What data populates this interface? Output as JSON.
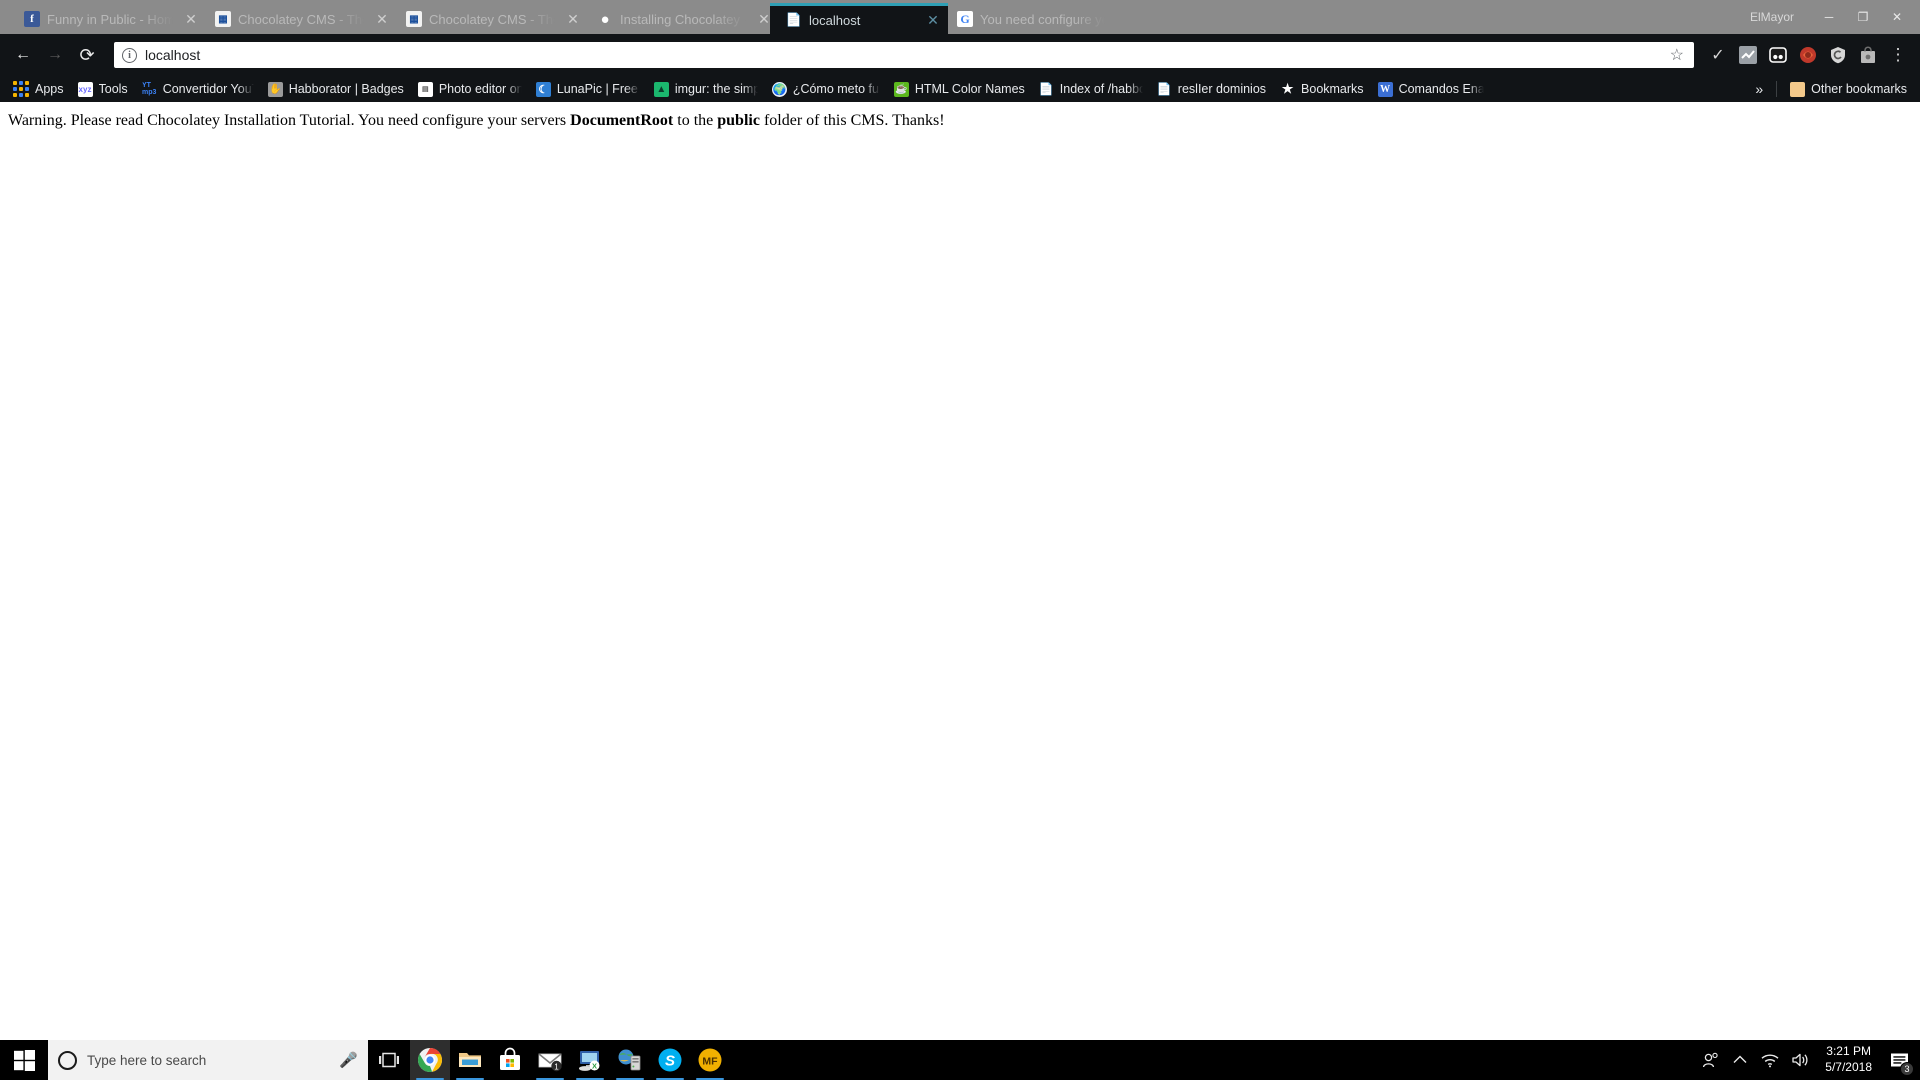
{
  "window": {
    "username": "ElMayor",
    "controls": [
      {
        "name": "minimize",
        "glyph": "─"
      },
      {
        "name": "maximize",
        "glyph": "❐"
      },
      {
        "name": "close",
        "glyph": "✕"
      }
    ]
  },
  "tabs": [
    {
      "title": "Funny in Public - Home",
      "favicon": "facebook-icon",
      "active": false
    },
    {
      "title": "Chocolatey CMS - The H",
      "favicon": "chocolatey-cms-icon",
      "active": false
    },
    {
      "title": "Chocolatey CMS - The H",
      "favicon": "chocolatey-cms-icon",
      "active": false
    },
    {
      "title": "Installing Chocolatey · c",
      "favicon": "github-icon",
      "active": false
    },
    {
      "title": "localhost",
      "favicon": "page-icon",
      "active": true
    },
    {
      "title": "You need configure you",
      "favicon": "google-icon",
      "active": false
    }
  ],
  "toolbar": {
    "back_label": "←",
    "forward_label": "→",
    "reload_label": "⟳",
    "info_glyph": "i",
    "url": "localhost",
    "star_glyph": "☆",
    "extensions": [
      {
        "name": "check-icon"
      },
      {
        "name": "chart-extension-icon"
      },
      {
        "name": "dice-extension-icon"
      },
      {
        "name": "firefox-monitor-extension-icon"
      },
      {
        "name": "shield-extension-icon"
      },
      {
        "name": "shopping-bag-extension-icon"
      }
    ],
    "menu_glyph": "⋮"
  },
  "bookmarks": {
    "apps_label": "Apps",
    "items": [
      {
        "label": "Tools",
        "icon": "xyz-icon",
        "icon_bg": "#ffffff",
        "icon_fg": "#6a6aff"
      },
      {
        "label": "Convertidor YouTube",
        "icon": "yt-mp3-icon",
        "icon_bg": "#111417",
        "icon_fg": "#3b82f6"
      },
      {
        "label": "Habborator | Badges",
        "icon": "habborator-icon",
        "icon_bg": "#9b9b9b",
        "icon_fg": "#f0f0f0"
      },
      {
        "label": "Photo editor online",
        "icon": "photo-editor-icon",
        "icon_bg": "#ffffff",
        "icon_fg": "#555555"
      },
      {
        "label": "LunaPic | Free Online",
        "icon": "lunapic-icon",
        "icon_bg": "#2f7fd4",
        "icon_fg": "#ffffff"
      },
      {
        "label": "imgur: the simple im",
        "icon": "imgur-icon",
        "icon_bg": "#1bb76e",
        "icon_fg": "#0b3d2c"
      },
      {
        "label": "¿Cómo meto furnis a",
        "icon": "globe-icon",
        "icon_bg": "#2f7fd4",
        "icon_fg": "#ffffff"
      },
      {
        "label": "HTML Color Names",
        "icon": "html-color-icon",
        "icon_bg": "#5cb81d",
        "icon_fg": "#ffffff"
      },
      {
        "label": "Index of /habboswf/",
        "icon": "page-icon",
        "icon_bg": "transparent",
        "icon_fg": "#ffffff"
      },
      {
        "label": "reslIer dominios",
        "icon": "page-icon",
        "icon_bg": "transparent",
        "icon_fg": "#ffffff"
      },
      {
        "label": "Bookmarks",
        "icon": "star-icon",
        "icon_bg": "transparent",
        "icon_fg": "#ffffff"
      },
      {
        "label": "Comandos Enable H",
        "icon": "wikipedia-icon",
        "icon_bg": "#3b6fd4",
        "icon_fg": "#ffffff"
      }
    ],
    "overflow_glyph": "»",
    "other_bookmarks_label": "Other bookmarks",
    "other_bookmarks_icon": "folder-icon"
  },
  "page": {
    "warning_prefix": "Warning. Please read Chocolatey Installation Tutorial. You need configure your servers ",
    "bold_1": "DocumentRoot",
    "warning_middle": " to the ",
    "bold_2": "public",
    "warning_suffix": " folder of this CMS. Thanks!"
  },
  "taskbar": {
    "start_icon": "windows-logo-icon",
    "search_placeholder": "Type here to search",
    "mic_icon": "microphone-icon",
    "taskview_icon": "task-view-icon",
    "apps": [
      {
        "name": "chrome",
        "icon": "chrome-icon",
        "active": true,
        "running": true,
        "badge": ""
      },
      {
        "name": "file-explorer",
        "icon": "folder-icon",
        "active": false,
        "running": true,
        "badge": ""
      },
      {
        "name": "microsoft-store",
        "icon": "store-icon",
        "active": false,
        "running": false,
        "badge": ""
      },
      {
        "name": "mail",
        "icon": "mail-icon",
        "active": false,
        "running": true,
        "badge": "1"
      },
      {
        "name": "remote-desktop",
        "icon": "remote-desktop-icon",
        "active": false,
        "running": true,
        "badge": ""
      },
      {
        "name": "network-server",
        "icon": "network-server-icon",
        "active": false,
        "running": true,
        "badge": ""
      },
      {
        "name": "skype",
        "icon": "skype-icon",
        "active": false,
        "running": true,
        "badge": ""
      },
      {
        "name": "mf-app",
        "icon": "mf-icon",
        "active": false,
        "running": true,
        "badge": ""
      }
    ],
    "tray": [
      {
        "name": "people-icon",
        "glyph": "⚹"
      },
      {
        "name": "show-hidden-icons-chevron",
        "glyph": "∧"
      },
      {
        "name": "wifi-icon",
        "glyph": "◠"
      },
      {
        "name": "volume-icon",
        "glyph": "🔊"
      }
    ],
    "time": "3:21 PM",
    "date": "5/7/2018",
    "action_center_badge": "3"
  },
  "colors": {
    "tabstrip_bg": "#8b8b8b",
    "toolbar_bg": "#111417",
    "active_tab_accent": "#2e9fb5",
    "taskbar_bg": "#000000",
    "taskbar_accent": "#3a96dd"
  }
}
